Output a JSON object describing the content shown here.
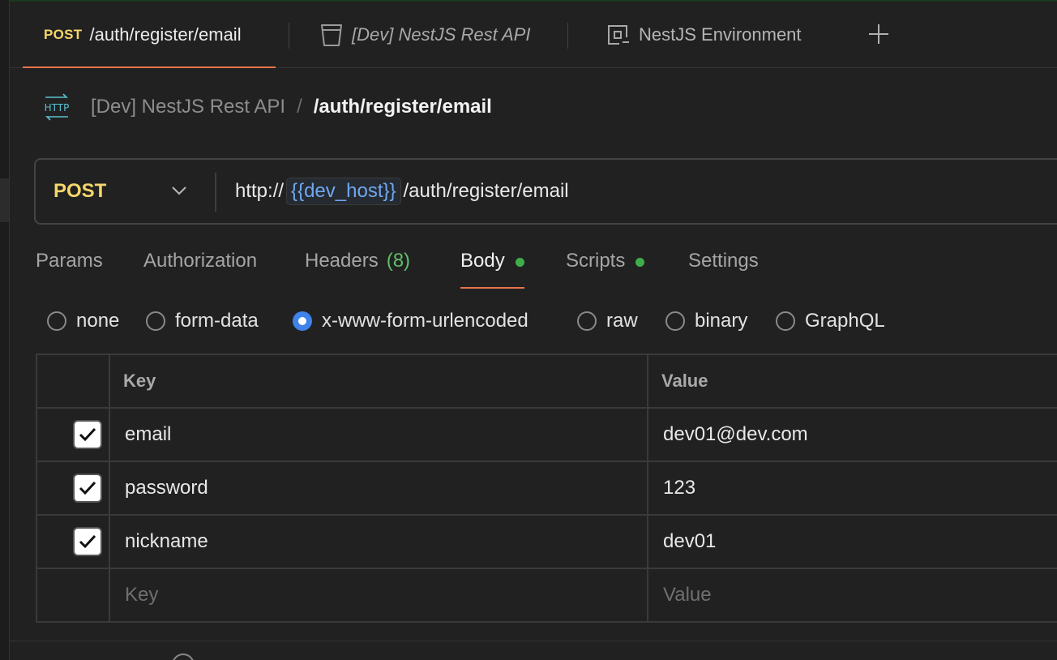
{
  "tabs": {
    "active": {
      "method": "POST",
      "label": "/auth/register/email"
    },
    "collection": {
      "label": "[Dev] NestJS Rest API",
      "icon": "collection-icon"
    },
    "environment": {
      "label": "NestJS Environment",
      "icon": "environment-icon"
    },
    "add_icon": "plus-icon"
  },
  "breadcrumb": {
    "icon": "HTTP",
    "collection": "[Dev] NestJS Rest API",
    "separator": "/",
    "current": "/auth/register/email"
  },
  "request": {
    "method": "POST",
    "url": {
      "scheme": "http://",
      "variable": "{{dev_host}}",
      "path": "/auth/register/email"
    }
  },
  "request_tabs": [
    {
      "label": "Params"
    },
    {
      "label": "Authorization"
    },
    {
      "label": "Headers",
      "count": "(8)"
    },
    {
      "label": "Body",
      "active": true,
      "indicator": true
    },
    {
      "label": "Scripts",
      "indicator": true
    },
    {
      "label": "Settings"
    }
  ],
  "body_types": [
    {
      "label": "none",
      "selected": false
    },
    {
      "label": "form-data",
      "selected": false
    },
    {
      "label": "x-www-form-urlencoded",
      "selected": true
    },
    {
      "label": "raw",
      "selected": false
    },
    {
      "label": "binary",
      "selected": false
    },
    {
      "label": "GraphQL",
      "selected": false
    }
  ],
  "table": {
    "headers": [
      "Key",
      "Value"
    ],
    "rows": [
      {
        "checked": true,
        "key": "email",
        "value": "dev01@dev.com"
      },
      {
        "checked": true,
        "key": "password",
        "value": "123"
      },
      {
        "checked": true,
        "key": "nickname",
        "value": "dev01"
      }
    ],
    "placeholder": {
      "key": "Key",
      "value": "Value"
    }
  },
  "colors": {
    "method": "#f4d66b",
    "accent": "#e8734a",
    "variable": "#6fa8f0",
    "indicator": "#3fae4a",
    "radio_selected": "#3f82ea"
  }
}
